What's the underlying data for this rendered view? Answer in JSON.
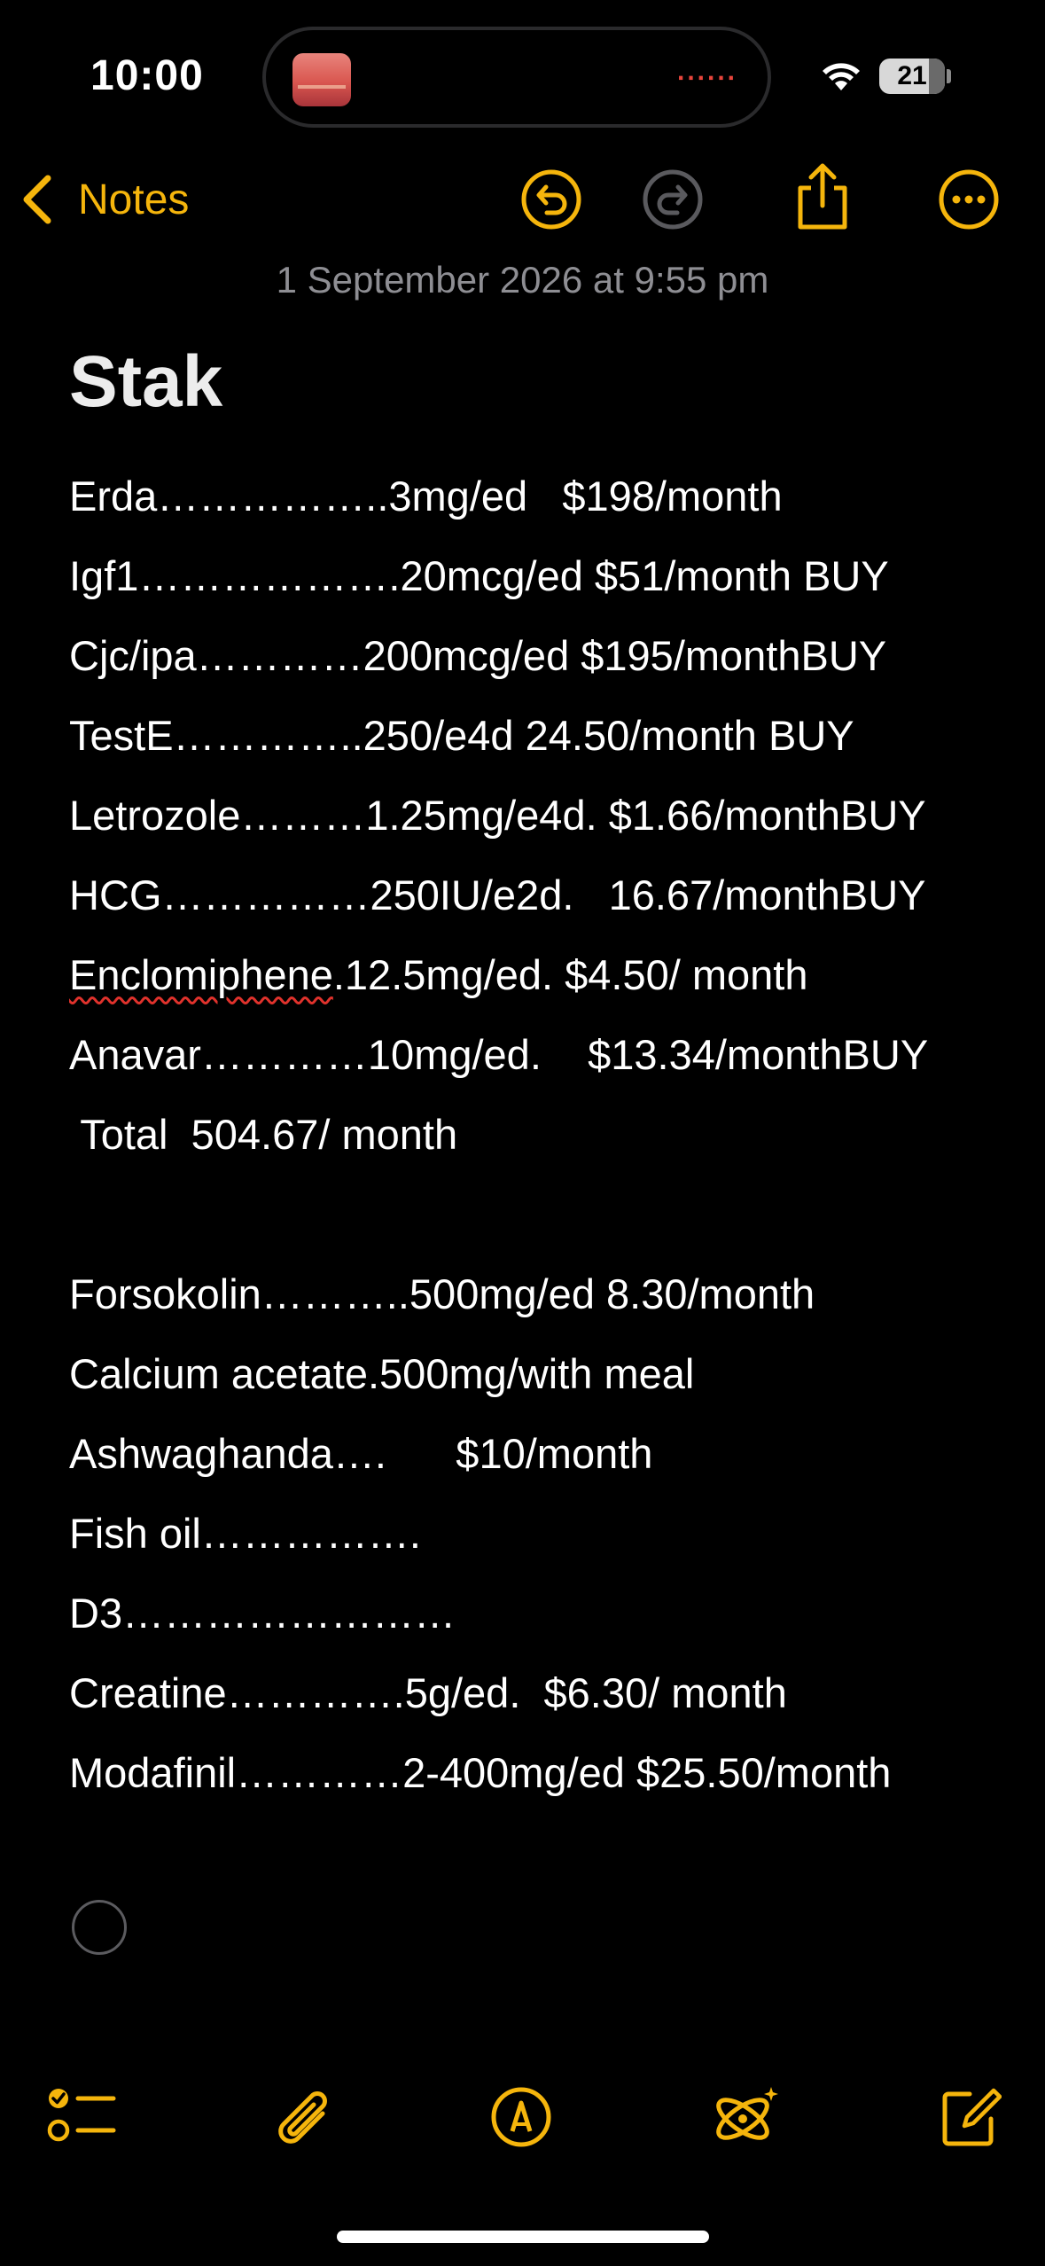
{
  "status": {
    "time": "10:00",
    "battery": "21"
  },
  "nav": {
    "back_label": "Notes"
  },
  "note": {
    "date": "1 September 2026 at 9:55 pm",
    "title": "Stak",
    "lines": [
      "Erda……………..3mg/ed   $198/month",
      "Igf1……………….20mcg/ed $51/month BUY",
      "Cjc/ipa…………200mcg/ed $195/monthBUY",
      "TestE…………..250/e4d 24.50/month BUY",
      "Letrozole………1.25mg/e4d. $1.66/monthBUY",
      "HCG……………250IU/e2d.   16.67/monthBUY",
      ".12.5mg/ed. $4.50/ month",
      "Anavar…………10mg/ed.    $13.34/monthBUY",
      " Total  504.67/ month",
      "",
      "Forsokolin………..500mg/ed 8.30/month",
      "Calcium acetate.500mg/with meal",
      "Ashwaghanda….      $10/month",
      "Fish oil…………….",
      "D3……………………",
      "Creatine………….5g/ed.  $6.30/ month",
      "Modafinil…………2-400mg/ed $25.50/month"
    ],
    "misspelled_word": "Enclomiphene"
  },
  "colors": {
    "accent": "#f5b50c",
    "background": "#000000",
    "secondary_text": "#8e8e93",
    "spellcheck": "#e0322c"
  },
  "icons": {
    "back": "chevron-left-icon",
    "undo": "undo-icon",
    "redo": "redo-icon",
    "share": "share-icon",
    "more": "more-icon",
    "checklist": "checklist-icon",
    "attachment": "paperclip-icon",
    "markup": "markup-pen-icon",
    "writing_tools": "writing-tools-icon",
    "compose": "compose-icon"
  }
}
